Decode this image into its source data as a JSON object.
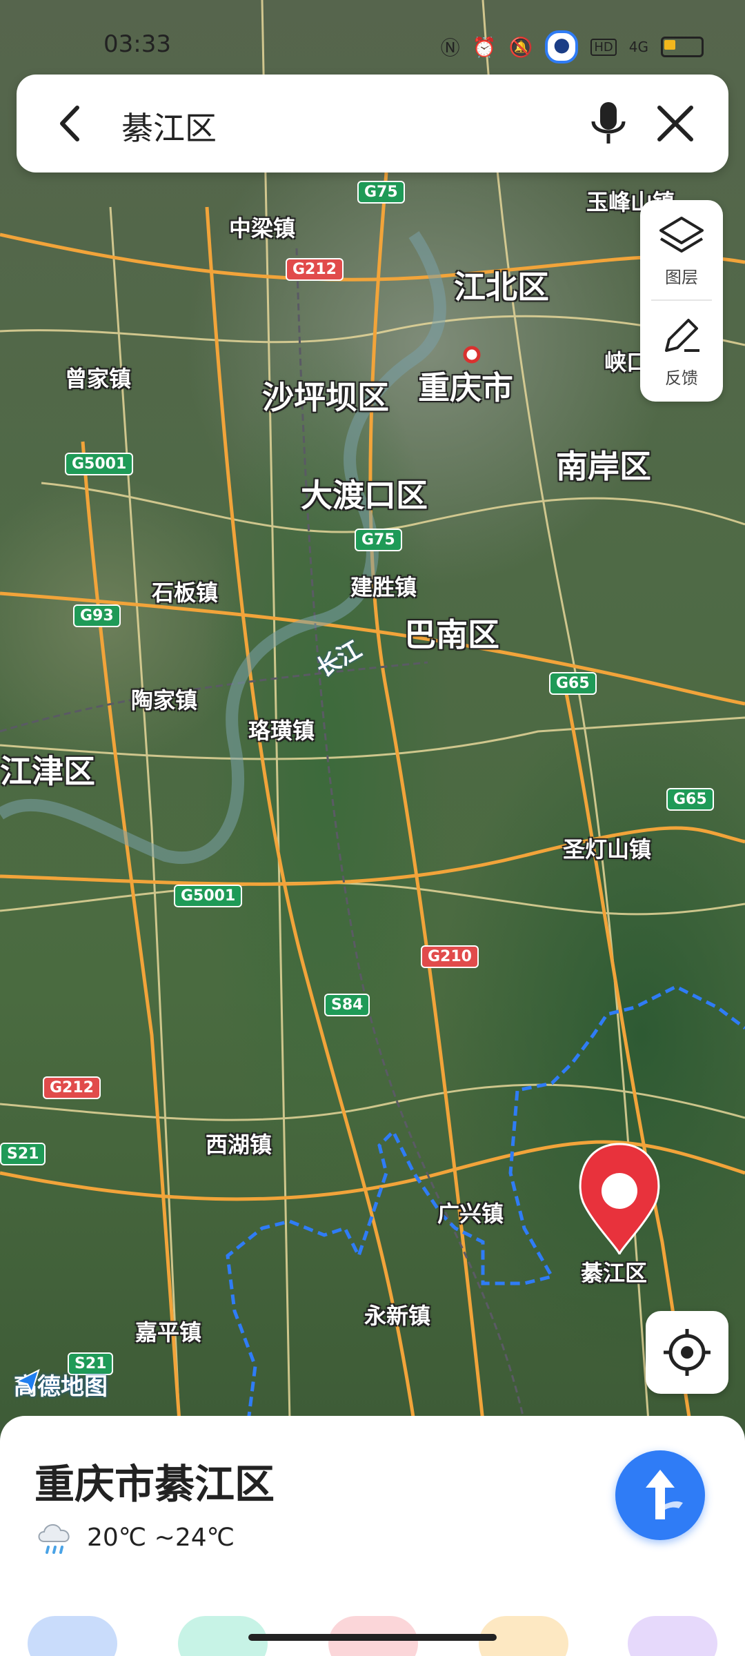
{
  "status_bar": {
    "time": "03:33",
    "icons": [
      "nfc-icon",
      "alarm-icon",
      "mute-icon",
      "location-icon",
      "hd-icon",
      "signal-4g-icon",
      "battery-icon"
    ],
    "network": "4G",
    "hd": "HD"
  },
  "search": {
    "query": "綦江区"
  },
  "side_panel": {
    "layers_label": "图层",
    "feedback_label": "反馈"
  },
  "map": {
    "labels_big": [
      "江北区",
      "沙坪坝区",
      "重庆市",
      "南岸区",
      "大渡口区",
      "巴南区",
      "江津区"
    ],
    "labels_mid": [
      "中梁镇",
      "玉峰山镇",
      "曾家镇",
      "峡口",
      "石板镇",
      "建胜镇",
      "陶家镇",
      "珞璜镇",
      "圣灯山镇",
      "西湖镇",
      "广兴镇",
      "永新镇",
      "嘉平镇"
    ],
    "river_label": "长江",
    "road_shields": [
      "G75",
      "G212",
      "G5001",
      "G75",
      "G93",
      "G65",
      "G65",
      "G5001",
      "G210",
      "S84",
      "G212",
      "S21",
      "S21"
    ],
    "pin_label": "綦江区",
    "logo_text": "高德地图",
    "colors": {
      "road_major": "#f2a43a",
      "road_minor": "#e6d79a",
      "boundary": "#2f7cf6",
      "pin": "#e8323c"
    }
  },
  "place": {
    "name": "重庆市綦江区",
    "weather": "20℃ ~24℃",
    "weather_icon": "rain-cloud-icon"
  },
  "chip_colors": [
    "#c9dcfb",
    "#c7f3e6",
    "#fbd6d9",
    "#fde8c2",
    "#e6d9fb"
  ]
}
